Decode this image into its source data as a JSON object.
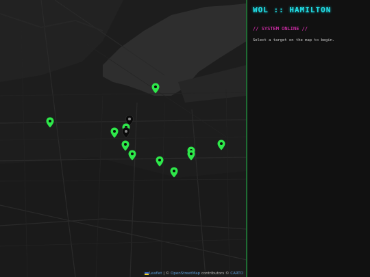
{
  "panel": {
    "title": "WOL :: HAMILTON",
    "status": "// SYSTEM ONLINE //",
    "hint": "Select a target on the map to begin."
  },
  "map": {
    "attribution": {
      "leaflet": "Leaflet",
      "sep": " | © ",
      "osm": "OpenStreetMap",
      "contributors": " contributors © ",
      "carto": "CARTO"
    },
    "marker_color_active": "#2ee84a",
    "marker_color_inactive": "#0a0a0a"
  }
}
